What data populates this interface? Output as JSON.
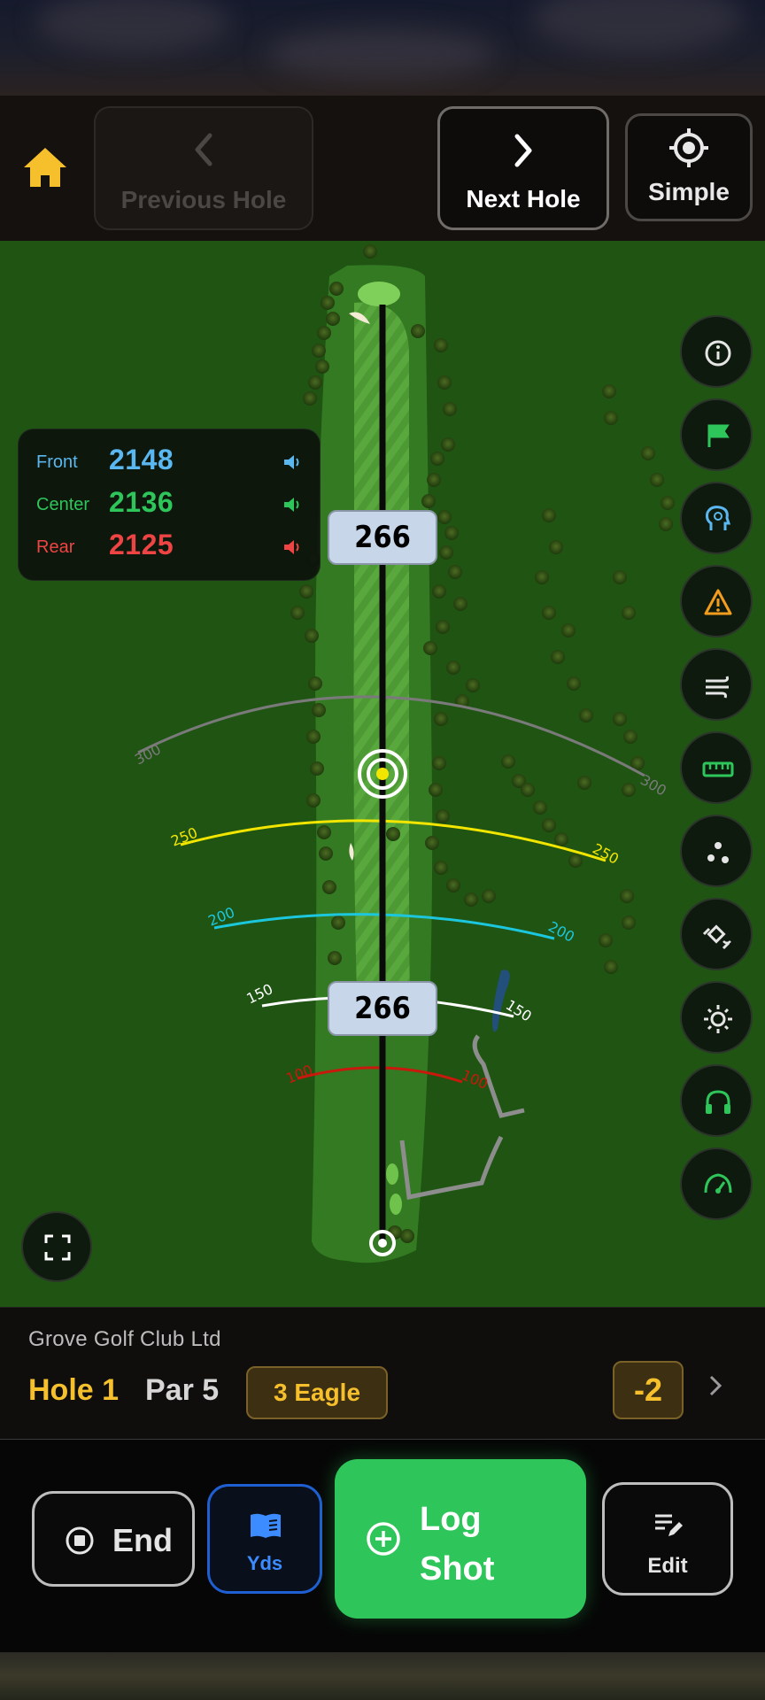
{
  "nav": {
    "previous_label": "Previous Hole",
    "next_label": "Next Hole",
    "simple_label": "Simple"
  },
  "distances": {
    "front_label": "Front",
    "front_value": "2148",
    "center_label": "Center",
    "center_value": "2136",
    "rear_label": "Rear",
    "rear_value": "2125"
  },
  "map": {
    "upper_yardage": "266",
    "lower_yardage": "266",
    "arcs": [
      {
        "label": "300",
        "color": "#7a7a7a"
      },
      {
        "label": "250",
        "color": "#f2e600"
      },
      {
        "label": "200",
        "color": "#1cc7de"
      },
      {
        "label": "150",
        "color": "#ffffff"
      },
      {
        "label": "100",
        "color": "#c8190c"
      }
    ]
  },
  "side_tools": [
    "info-icon",
    "flag-icon",
    "caddie-icon",
    "hazard-icon",
    "wind-icon",
    "ruler-icon",
    "dots-icon",
    "gps-icon",
    "brightness-icon",
    "headset-icon",
    "speedometer-icon"
  ],
  "info": {
    "club_name": "Grove Golf Club Ltd",
    "hole": "Hole 1",
    "par": "Par 5",
    "score": "3  Eagle",
    "total": "-2"
  },
  "actions": {
    "end_label": "End",
    "yds_label": "Yds",
    "log_label_1": "Log",
    "log_label_2": "Shot",
    "edit_label": "Edit"
  },
  "colors": {
    "accent": "#f6c02d",
    "log_green": "#2ec55a",
    "front": "#5ab7f0",
    "center": "#2ec55a",
    "rear": "#ef4444"
  }
}
